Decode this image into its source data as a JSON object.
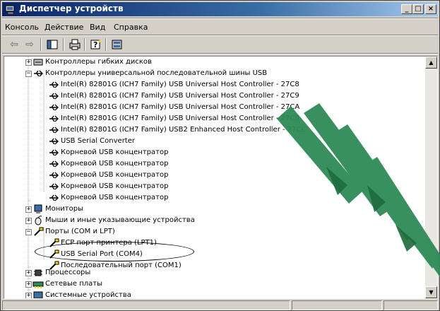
{
  "window": {
    "title": "Диспетчер устройств",
    "buttons": {
      "minimize": "_",
      "maximize": "□",
      "close": "×"
    }
  },
  "menu": [
    "Консоль",
    "Действие",
    "Вид",
    "Справка"
  ],
  "toolbar": {
    "back": "⇦",
    "forward": "⇨",
    "tree": "▣",
    "print": "🖶",
    "help": "?",
    "properties": "▦"
  },
  "tree": {
    "floppy_controllers": "Контроллеры гибких дисков",
    "usb_controllers": "Контроллеры универсальной последовательной шины USB",
    "usb_items": [
      "Intel(R) 82801G (ICH7 Family) USB Universal Host Controller - 27C8",
      "Intel(R) 82801G (ICH7 Family) USB Universal Host Controller - 27C9",
      "Intel(R) 82801G (ICH7 Family) USB Universal Host Controller - 27CA",
      "Intel(R) 82801G (ICH7 Family) USB Universal Host Controller - 27CB",
      "Intel(R) 82801G (ICH7 Family) USB2 Enhanced Host Controller - 27CC",
      "USB Serial Converter",
      "Корневой USB концентратор",
      "Корневой USB концентратор",
      "Корневой USB концентратор",
      "Корневой USB концентратор",
      "Корневой USB концентратор"
    ],
    "monitors": "Мониторы",
    "mice": "Мыши и иные указывающие устройства",
    "ports": "Порты (COM и LPT)",
    "port_items": [
      "ECP порт принтера (LPT1)",
      "USB Serial Port (COM4)",
      "Последовательный порт (COM1)"
    ],
    "processors": "Процессоры",
    "network": "Сетевые платы",
    "system": "Системные устройства"
  },
  "colors": {
    "titlebar": "#0a246a",
    "watermark": "#2e8b57",
    "watermark_dark": "#1e6b3e"
  }
}
